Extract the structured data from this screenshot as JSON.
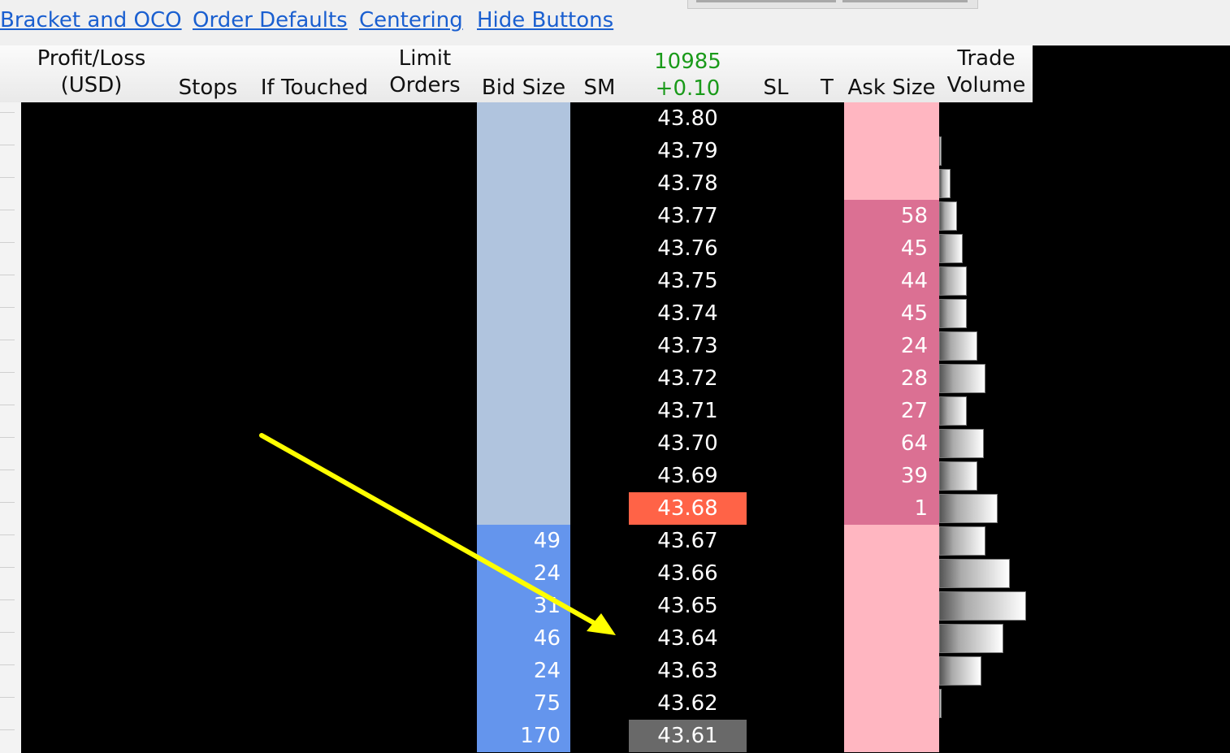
{
  "links": [
    "Bracket and OCO",
    "Order Defaults",
    "Centering",
    "Hide Buttons"
  ],
  "header": {
    "pnl_line1": "Profit/Loss",
    "pnl_line2": "(USD)",
    "stops": "Stops",
    "if_touched": "If Touched",
    "limit_line1": "Limit",
    "limit_line2": "Orders",
    "bid_size": "Bid Size",
    "sm": "SM",
    "last_volume": "10985",
    "net_change": "+0.10",
    "sl": "SL",
    "t": "T",
    "ask_size": "Ask Size",
    "trade_line1": "Trade",
    "trade_line2": "Volume"
  },
  "colors": {
    "bid_light": "#b0c4de",
    "bid_active": "#6495ed",
    "ask_light": "#ffb6c1",
    "ask_active": "#db7093",
    "last_price": "#ff6347",
    "current_price": "#696969",
    "arrow": "#ffff00"
  },
  "ladder": [
    {
      "price": "43.80",
      "bid": "",
      "ask": "",
      "volume": 0
    },
    {
      "price": "43.79",
      "bid": "",
      "ask": "",
      "volume": 2
    },
    {
      "price": "43.78",
      "bid": "",
      "ask": "",
      "volume": 14
    },
    {
      "price": "43.77",
      "bid": "",
      "ask": "58",
      "volume": 22
    },
    {
      "price": "43.76",
      "bid": "",
      "ask": "45",
      "volume": 29
    },
    {
      "price": "43.75",
      "bid": "",
      "ask": "44",
      "volume": 34
    },
    {
      "price": "43.74",
      "bid": "",
      "ask": "45",
      "volume": 34
    },
    {
      "price": "43.73",
      "bid": "",
      "ask": "24",
      "volume": 47
    },
    {
      "price": "43.72",
      "bid": "",
      "ask": "28",
      "volume": 57
    },
    {
      "price": "43.71",
      "bid": "",
      "ask": "27",
      "volume": 34
    },
    {
      "price": "43.70",
      "bid": "",
      "ask": "64",
      "volume": 55
    },
    {
      "price": "43.69",
      "bid": "",
      "ask": "39",
      "volume": 47
    },
    {
      "price": "43.68",
      "bid": "",
      "ask": "1",
      "volume": 72,
      "highlight": "last"
    },
    {
      "price": "43.67",
      "bid": "49",
      "ask": "",
      "volume": 57
    },
    {
      "price": "43.66",
      "bid": "24",
      "ask": "",
      "volume": 87
    },
    {
      "price": "43.65",
      "bid": "31",
      "ask": "",
      "volume": 107
    },
    {
      "price": "43.64",
      "bid": "46",
      "ask": "",
      "volume": 79
    },
    {
      "price": "43.63",
      "bid": "24",
      "ask": "",
      "volume": 52
    },
    {
      "price": "43.62",
      "bid": "75",
      "ask": "",
      "volume": 2
    },
    {
      "price": "43.61",
      "bid": "170",
      "ask": "",
      "volume": 0,
      "highlight": "current"
    }
  ]
}
